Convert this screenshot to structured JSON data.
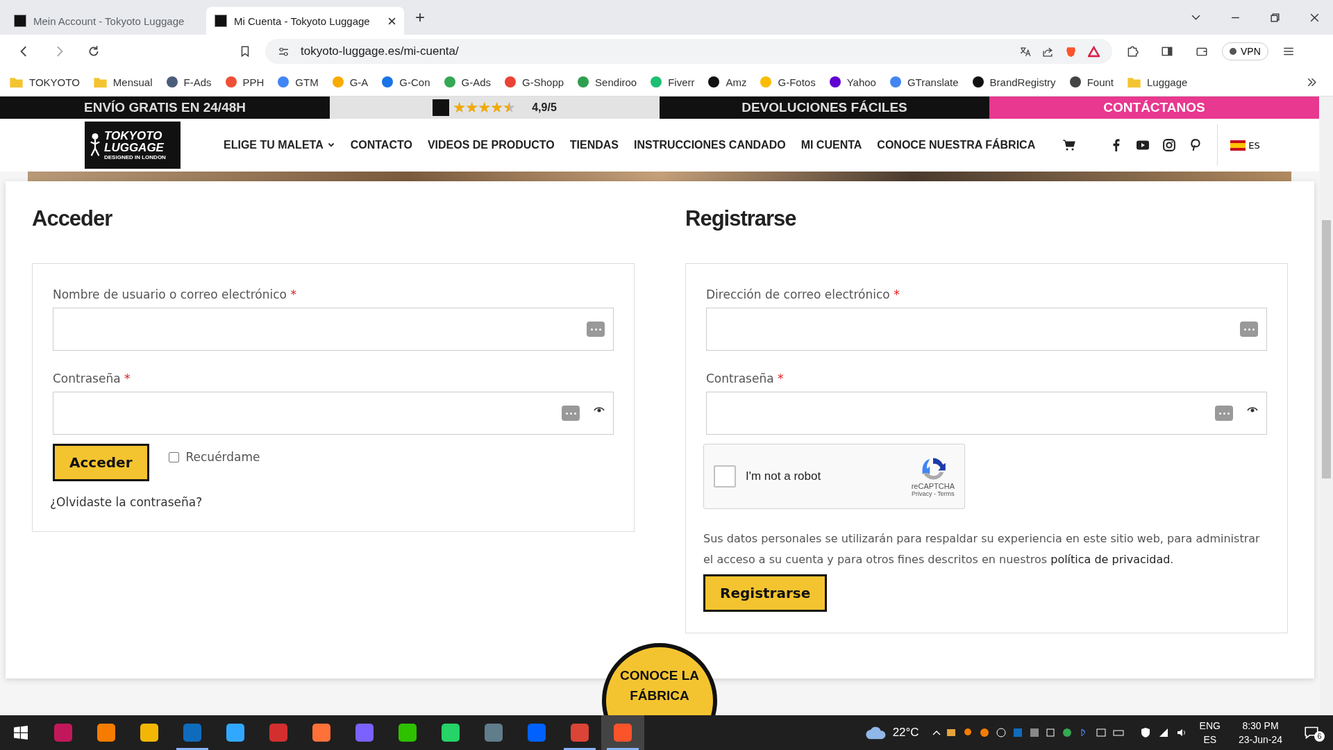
{
  "browser": {
    "tabs": [
      {
        "title": "Mein Account - Tokyoto Luggage",
        "selected": false
      },
      {
        "title": "Mi Cuenta - Tokyoto Luggage",
        "selected": true
      }
    ],
    "new_tab": "+",
    "address": "tokyoto-luggage.es/mi-cuenta/",
    "vpn": "VPN",
    "bookmarks": [
      {
        "label": "TOKYOTO",
        "kind": "folder"
      },
      {
        "label": "Mensual",
        "kind": "folder"
      },
      {
        "label": "F-Ads",
        "kind": "site",
        "color": "#4a5d7a"
      },
      {
        "label": "PPH",
        "kind": "site",
        "color": "#f04e37"
      },
      {
        "label": "GTM",
        "kind": "site",
        "color": "#4285f4"
      },
      {
        "label": "G-A",
        "kind": "site",
        "color": "#f9ab00"
      },
      {
        "label": "G-Con",
        "kind": "site",
        "color": "#1a73e8"
      },
      {
        "label": "G-Ads",
        "kind": "site",
        "color": "#34a853"
      },
      {
        "label": "G-Shopp",
        "kind": "site",
        "color": "#ea4335"
      },
      {
        "label": "Sendiroo",
        "kind": "site",
        "color": "#2e9e4f"
      },
      {
        "label": "Fiverr",
        "kind": "site",
        "color": "#1dbf73"
      },
      {
        "label": "Amz",
        "kind": "site",
        "color": "#111111"
      },
      {
        "label": "G-Fotos",
        "kind": "site",
        "color": "#fbbc04"
      },
      {
        "label": "Yahoo",
        "kind": "site",
        "color": "#6001d2"
      },
      {
        "label": "GTranslate",
        "kind": "site",
        "color": "#4285f4"
      },
      {
        "label": "BrandRegistry",
        "kind": "site",
        "color": "#111111"
      },
      {
        "label": "Fount",
        "kind": "site",
        "color": "#444444"
      },
      {
        "label": "Luggage",
        "kind": "folder"
      }
    ]
  },
  "site": {
    "topbar": [
      {
        "kind": "text",
        "text": "ENVÍO GRATIS EN 24/48H"
      },
      {
        "kind": "rating",
        "text": "4,9/5",
        "stars": 4.5
      },
      {
        "kind": "text",
        "text": "DEVOLUCIONES FÁCILES"
      },
      {
        "kind": "contact",
        "text": "CONTÁCTANOS"
      }
    ],
    "logo": {
      "line1": "TOKYOTO",
      "line2": "LUGGAGE",
      "tagline": "DESIGNED IN LONDON"
    },
    "nav": [
      {
        "label": "ELIGE TU MALETA",
        "dropdown": true
      },
      {
        "label": "CONTACTO",
        "dropdown": false
      },
      {
        "label": "VIDEOS DE PRODUCTO",
        "dropdown": false
      },
      {
        "label": "TIENDAS",
        "dropdown": false
      },
      {
        "label": "INSTRUCCIONES CANDADO",
        "dropdown": false
      },
      {
        "label": "MI CUENTA",
        "dropdown": false
      },
      {
        "label": "CONOCE NUESTRA FÁBRICA",
        "dropdown": false
      }
    ],
    "language": "ES"
  },
  "login": {
    "heading": "Acceder",
    "fields": [
      {
        "label": "Nombre de usuario o correo electrónico",
        "required_mark": "*",
        "kind": "text"
      },
      {
        "label": "Contraseña",
        "required_mark": "*",
        "kind": "password"
      }
    ],
    "button": "Acceder",
    "remember": {
      "label": "Recuérdame",
      "checked": false
    },
    "forgot": "¿Olvidaste la contraseña?"
  },
  "register": {
    "heading": "Registrarse",
    "fields": [
      {
        "label": "Dirección de correo electrónico",
        "required_mark": "*",
        "kind": "text"
      },
      {
        "label": "Contraseña",
        "required_mark": "*",
        "kind": "password"
      }
    ],
    "captcha": {
      "label": "I'm not a robot",
      "checked": false,
      "brand": "reCAPTCHA",
      "privacy": "Privacy",
      "separator": "-",
      "terms": "Terms"
    },
    "privacy_text": "Sus datos personales se utilizarán para respaldar su experiencia en este sitio web, para administrar el acceso a su cuenta y para otros fines descritos en nuestros ",
    "privacy_link": "política de privacidad",
    "privacy_end": ".",
    "button": "Registrarse"
  },
  "floating_badge": {
    "line1": "CONOCE LA",
    "line2": "FÁBRICA"
  },
  "taskbar": {
    "apps": [
      {
        "running": false,
        "selected": false
      },
      {
        "running": false,
        "selected": false
      },
      {
        "running": false,
        "selected": false
      },
      {
        "running": true,
        "selected": false
      },
      {
        "running": false,
        "selected": false
      },
      {
        "running": false,
        "selected": false
      },
      {
        "running": false,
        "selected": false
      },
      {
        "running": false,
        "selected": false
      },
      {
        "running": false,
        "selected": false
      },
      {
        "running": false,
        "selected": false
      },
      {
        "running": false,
        "selected": false
      },
      {
        "running": false,
        "selected": false
      },
      {
        "running": true,
        "selected": false
      },
      {
        "running": true,
        "selected": true
      }
    ],
    "weather": "22°C",
    "lang1": "ENG",
    "lang2": "ES",
    "time": "8:30 PM",
    "date": "23-Jun-24",
    "notifications": "6"
  }
}
